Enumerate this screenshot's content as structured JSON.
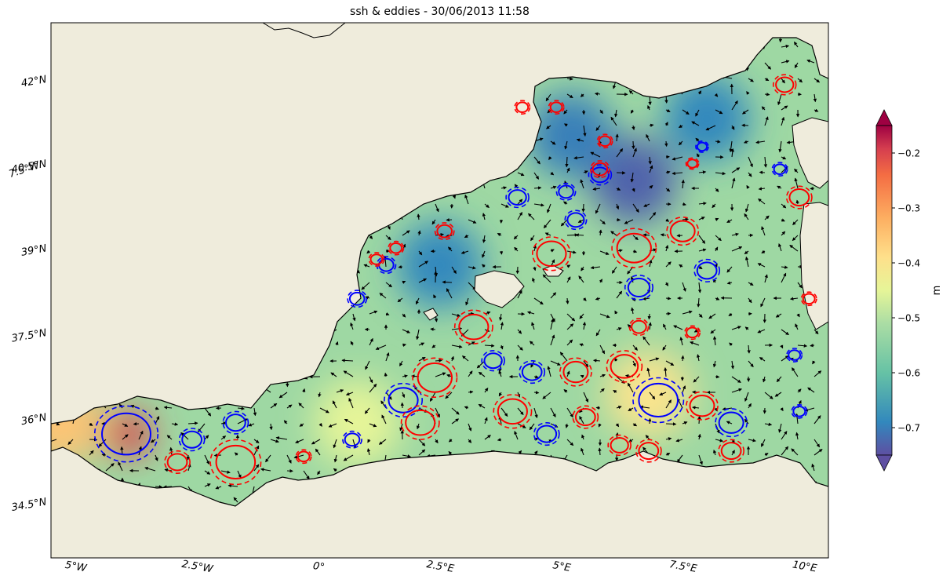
{
  "chart_data": {
    "type": "heatmap",
    "title": "ssh & eddies - 30/06/2013 11:58",
    "colorbar": {
      "label": "m",
      "colormap": "Spectral_r",
      "range": [
        -0.75,
        -0.15
      ],
      "extend": "both",
      "ticks": [
        "−0.2",
        "−0.3",
        "−0.4",
        "−0.5",
        "−0.6",
        "−0.7"
      ],
      "tick_values": [
        -0.2,
        -0.3,
        -0.4,
        -0.5,
        -0.6,
        -0.7
      ]
    },
    "lon_ticks": [
      {
        "value": -5,
        "label": "5°W"
      },
      {
        "value": -2.5,
        "label": "2.5°W"
      },
      {
        "value": 0,
        "label": "0°"
      },
      {
        "value": 2.5,
        "label": "2.5°E"
      },
      {
        "value": 5,
        "label": "5°E"
      },
      {
        "value": 7.5,
        "label": "7.5°E"
      },
      {
        "value": 10,
        "label": "10°E"
      },
      {
        "value": -7.5,
        "label": "7.5°W"
      }
    ],
    "lat_ticks": [
      {
        "value": 42,
        "label": "42°N"
      },
      {
        "value": 40.5,
        "label": "40.5°N"
      },
      {
        "value": 39,
        "label": "39°N"
      },
      {
        "value": 37.5,
        "label": "37.5°N"
      },
      {
        "value": 36,
        "label": "36°N"
      },
      {
        "value": 34.5,
        "label": "34.5°N"
      }
    ],
    "extent": {
      "lon": [
        -5.5,
        10.5
      ],
      "lat": [
        33.5,
        43
      ]
    },
    "land_color": "#efecdc",
    "coast_color": "#000000",
    "ssh_features": [
      {
        "lon": -3.9,
        "lat": 35.7,
        "value": -0.2
      },
      {
        "lon": 6.8,
        "lat": 36.4,
        "value": -0.4
      },
      {
        "lon": 0.8,
        "lat": 35.9,
        "value": -0.45
      },
      {
        "lon": -5.3,
        "lat": 35.9,
        "value": -0.35
      },
      {
        "lon": 6.5,
        "lat": 40.2,
        "value": -0.73
      },
      {
        "lon": 5.2,
        "lat": 41.0,
        "value": -0.7
      },
      {
        "lon": 2.5,
        "lat": 38.7,
        "value": -0.69
      },
      {
        "lon": 8.0,
        "lat": 41.3,
        "value": -0.69
      }
    ],
    "eddies": {
      "cyclonic_color": "#0000ff",
      "anticyclonic_color": "#ff0000",
      "items": [
        {
          "kind": "cyclonic",
          "lon": -3.95,
          "lat": 35.7,
          "r": 0.5
        },
        {
          "kind": "cyclonic",
          "lon": -2.6,
          "lat": 35.6,
          "r": 0.2
        },
        {
          "kind": "cyclonic",
          "lon": -1.7,
          "lat": 35.9,
          "r": 0.2
        },
        {
          "kind": "cyclonic",
          "lon": 0.7,
          "lat": 35.6,
          "r": 0.15
        },
        {
          "kind": "cyclonic",
          "lon": 1.75,
          "lat": 36.3,
          "r": 0.3
        },
        {
          "kind": "cyclonic",
          "lon": 3.6,
          "lat": 37.0,
          "r": 0.18
        },
        {
          "kind": "cyclonic",
          "lon": 4.4,
          "lat": 36.8,
          "r": 0.2
        },
        {
          "kind": "cyclonic",
          "lon": 4.7,
          "lat": 35.7,
          "r": 0.2
        },
        {
          "kind": "cyclonic",
          "lon": 6.6,
          "lat": 38.3,
          "r": 0.22
        },
        {
          "kind": "cyclonic",
          "lon": 7.0,
          "lat": 36.3,
          "r": 0.4
        },
        {
          "kind": "cyclonic",
          "lon": 8.0,
          "lat": 38.6,
          "r": 0.2
        },
        {
          "kind": "cyclonic",
          "lon": 8.5,
          "lat": 35.9,
          "r": 0.25
        },
        {
          "kind": "cyclonic",
          "lon": 9.9,
          "lat": 36.1,
          "r": 0.12
        },
        {
          "kind": "cyclonic",
          "lon": 9.5,
          "lat": 40.4,
          "r": 0.12
        },
        {
          "kind": "cyclonic",
          "lon": 4.1,
          "lat": 39.9,
          "r": 0.18
        },
        {
          "kind": "cyclonic",
          "lon": 1.4,
          "lat": 38.7,
          "r": 0.15
        },
        {
          "kind": "cyclonic",
          "lon": 0.8,
          "lat": 38.1,
          "r": 0.15
        },
        {
          "kind": "cyclonic",
          "lon": 5.3,
          "lat": 39.5,
          "r": 0.17
        },
        {
          "kind": "cyclonic",
          "lon": 5.1,
          "lat": 40.0,
          "r": 0.15
        },
        {
          "kind": "cyclonic",
          "lon": 5.8,
          "lat": 40.3,
          "r": 0.18
        },
        {
          "kind": "cyclonic",
          "lon": 7.9,
          "lat": 40.8,
          "r": 0.1
        },
        {
          "kind": "cyclonic",
          "lon": 9.8,
          "lat": 37.1,
          "r": 0.12
        },
        {
          "kind": "anticyclonic",
          "lon": -2.9,
          "lat": 35.2,
          "r": 0.2
        },
        {
          "kind": "anticyclonic",
          "lon": -1.7,
          "lat": 35.2,
          "r": 0.4
        },
        {
          "kind": "anticyclonic",
          "lon": -0.3,
          "lat": 35.3,
          "r": 0.12
        },
        {
          "kind": "anticyclonic",
          "lon": 2.1,
          "lat": 35.9,
          "r": 0.3
        },
        {
          "kind": "anticyclonic",
          "lon": 2.4,
          "lat": 36.7,
          "r": 0.35
        },
        {
          "kind": "anticyclonic",
          "lon": 3.2,
          "lat": 37.6,
          "r": 0.3
        },
        {
          "kind": "anticyclonic",
          "lon": 4.0,
          "lat": 36.1,
          "r": 0.3
        },
        {
          "kind": "anticyclonic",
          "lon": 5.3,
          "lat": 36.8,
          "r": 0.25
        },
        {
          "kind": "anticyclonic",
          "lon": 6.3,
          "lat": 36.9,
          "r": 0.28
        },
        {
          "kind": "anticyclonic",
          "lon": 5.5,
          "lat": 36.0,
          "r": 0.2
        },
        {
          "kind": "anticyclonic",
          "lon": 6.2,
          "lat": 35.5,
          "r": 0.18
        },
        {
          "kind": "anticyclonic",
          "lon": 6.8,
          "lat": 35.4,
          "r": 0.2
        },
        {
          "kind": "anticyclonic",
          "lon": 7.9,
          "lat": 36.2,
          "r": 0.25
        },
        {
          "kind": "anticyclonic",
          "lon": 8.5,
          "lat": 35.4,
          "r": 0.2
        },
        {
          "kind": "anticyclonic",
          "lon": 4.8,
          "lat": 38.9,
          "r": 0.3
        },
        {
          "kind": "anticyclonic",
          "lon": 6.5,
          "lat": 39.0,
          "r": 0.35
        },
        {
          "kind": "anticyclonic",
          "lon": 7.5,
          "lat": 39.3,
          "r": 0.25
        },
        {
          "kind": "anticyclonic",
          "lon": 6.6,
          "lat": 37.6,
          "r": 0.15
        },
        {
          "kind": "anticyclonic",
          "lon": 7.7,
          "lat": 37.5,
          "r": 0.12
        },
        {
          "kind": "anticyclonic",
          "lon": 2.6,
          "lat": 39.3,
          "r": 0.15
        },
        {
          "kind": "anticyclonic",
          "lon": 1.6,
          "lat": 39.0,
          "r": 0.12
        },
        {
          "kind": "anticyclonic",
          "lon": 1.2,
          "lat": 38.8,
          "r": 0.12
        },
        {
          "kind": "anticyclonic",
          "lon": 5.8,
          "lat": 40.4,
          "r": 0.15
        },
        {
          "kind": "anticyclonic",
          "lon": 5.9,
          "lat": 40.9,
          "r": 0.12
        },
        {
          "kind": "anticyclonic",
          "lon": 7.7,
          "lat": 40.5,
          "r": 0.1
        },
        {
          "kind": "anticyclonic",
          "lon": 9.9,
          "lat": 39.9,
          "r": 0.2
        },
        {
          "kind": "anticyclonic",
          "lon": 9.6,
          "lat": 41.9,
          "r": 0.18
        },
        {
          "kind": "anticyclonic",
          "lon": 4.9,
          "lat": 41.5,
          "r": 0.12
        },
        {
          "kind": "anticyclonic",
          "lon": 4.2,
          "lat": 41.5,
          "r": 0.12
        },
        {
          "kind": "anticyclonic",
          "lon": 10.1,
          "lat": 38.1,
          "r": 0.12
        }
      ]
    }
  }
}
